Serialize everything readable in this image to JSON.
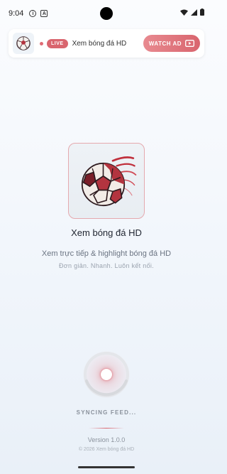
{
  "status_bar": {
    "time": "9:04",
    "icons": [
      "info-icon",
      "a-icon",
      "wifi-icon",
      "signal-icon",
      "battery-icon"
    ]
  },
  "ad_banner": {
    "live_label": "LIVE",
    "title": "Xem bóng đá HD",
    "cta_label": "WATCH AD",
    "accent_color": "#d9656e"
  },
  "splash": {
    "app_name": "Xem bóng đá HD",
    "tagline": "Xem trực tiếp & highlight bóng đá HD",
    "subtagline": "Đơn giản. Nhanh. Luôn kết nối."
  },
  "loader": {
    "status_text": "SYNCING FEED..."
  },
  "footer": {
    "version": "Version 1.0.0",
    "copyright": "© 2026 Xem bóng đá HD"
  }
}
